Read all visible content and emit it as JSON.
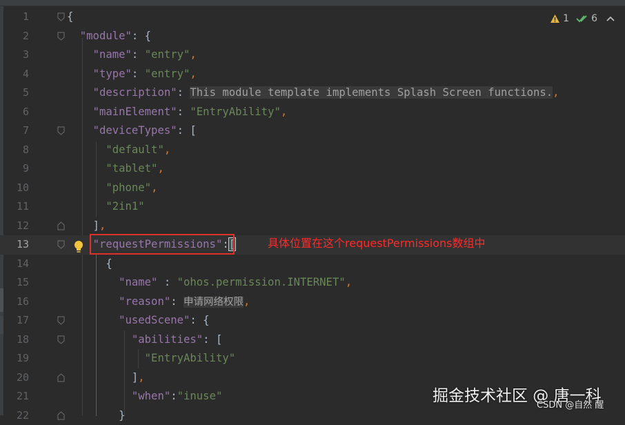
{
  "status": {
    "warnings": "1",
    "checks": "6"
  },
  "lines": [
    {
      "num": "1",
      "indent": 0
    },
    {
      "num": "2",
      "indent": 1
    },
    {
      "num": "3",
      "indent": 2,
      "key": "\"name\"",
      "value": "\"entry\""
    },
    {
      "num": "4",
      "indent": 2,
      "key": "\"type\"",
      "value": "\"entry\""
    },
    {
      "num": "5",
      "indent": 2,
      "key": "\"description\"",
      "value": "This module template implements Splash Screen functions."
    },
    {
      "num": "6",
      "indent": 2,
      "key": "\"mainElement\"",
      "value": "\"EntryAbility\""
    },
    {
      "num": "7",
      "indent": 2,
      "key": "\"deviceTypes\""
    },
    {
      "num": "8",
      "indent": 3,
      "value": "\"default\""
    },
    {
      "num": "9",
      "indent": 3,
      "value": "\"tablet\""
    },
    {
      "num": "10",
      "indent": 3,
      "value": "\"phone\""
    },
    {
      "num": "11",
      "indent": 3,
      "value": "\"2in1\""
    },
    {
      "num": "12",
      "indent": 2
    },
    {
      "num": "13",
      "indent": 2,
      "key": "\"requestPermissions\""
    },
    {
      "num": "14",
      "indent": 3
    },
    {
      "num": "15",
      "indent": 4,
      "key": "\"name\"",
      "value": "\"ohos.permission.INTERNET\""
    },
    {
      "num": "16",
      "indent": 4,
      "key": "\"reason\"",
      "value": "申请网络权限"
    },
    {
      "num": "17",
      "indent": 4,
      "key": "\"usedScene\""
    },
    {
      "num": "18",
      "indent": 5,
      "key": "\"abilities\""
    },
    {
      "num": "19",
      "indent": 6,
      "value": "\"EntryAbility\""
    },
    {
      "num": "20",
      "indent": 5
    },
    {
      "num": "21",
      "indent": 5,
      "key": "\"when\"",
      "value": "\"inuse\""
    },
    {
      "num": "22",
      "indent": 4
    }
  ],
  "code": {
    "module_key": "\"module\""
  },
  "annotation": "具体位置在这个requestPermissions数组中",
  "watermark": "掘金技术社区 @ 唐一科",
  "watermark_small": "CSDN @自然 醒"
}
